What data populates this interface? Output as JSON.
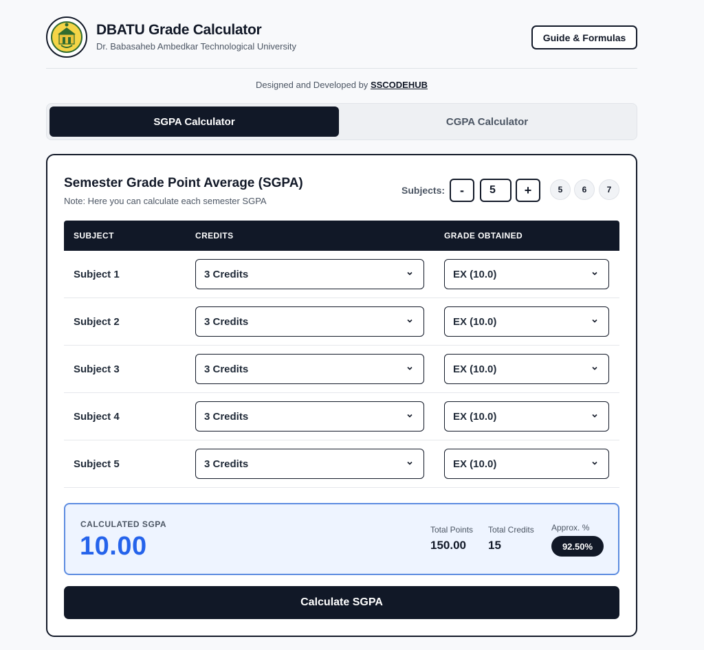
{
  "header": {
    "title": "DBATU Grade Calculator",
    "subtitle": "Dr. Babasaheb Ambedkar Technological University",
    "guide_button": "Guide & Formulas",
    "logo_icon": "university-emblem-icon"
  },
  "credit_line": {
    "prefix": "Designed and Developed by",
    "link": "SSCODEHUB"
  },
  "tabs": [
    {
      "label": "SGPA Calculator",
      "active": true
    },
    {
      "label": "CGPA Calculator",
      "active": false
    }
  ],
  "card": {
    "title": "Semester Grade Point Average (SGPA)",
    "note": "Note: Here you can calculate each semester SGPA",
    "subjects_label": "Subjects:",
    "decrement": "-",
    "count": "5",
    "increment": "+",
    "quick_counts": [
      "5",
      "6",
      "7"
    ]
  },
  "table": {
    "headers": [
      "SUBJECT",
      "CREDITS",
      "GRADE OBTAINED"
    ],
    "rows": [
      {
        "subject": "Subject 1",
        "credits": "3 Credits",
        "grade": "EX (10.0)"
      },
      {
        "subject": "Subject 2",
        "credits": "3 Credits",
        "grade": "EX (10.0)"
      },
      {
        "subject": "Subject 3",
        "credits": "3 Credits",
        "grade": "EX (10.0)"
      },
      {
        "subject": "Subject 4",
        "credits": "3 Credits",
        "grade": "EX (10.0)"
      },
      {
        "subject": "Subject 5",
        "credits": "3 Credits",
        "grade": "EX (10.0)"
      }
    ]
  },
  "result": {
    "label": "CALCULATED SGPA",
    "value": "10.00",
    "total_points_label": "Total Points",
    "total_points": "150.00",
    "total_credits_label": "Total Credits",
    "total_credits": "15",
    "approx_label": "Approx. %",
    "approx_value": "92.50%"
  },
  "calculate_button": "Calculate SGPA",
  "colors": {
    "primary": "#111827",
    "accent": "#2563eb",
    "result_bg": "#eef4ff",
    "result_border": "#5b8be0"
  }
}
